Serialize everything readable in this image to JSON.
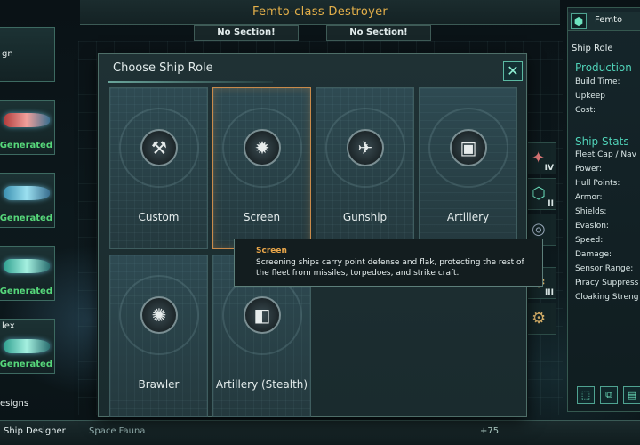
{
  "design": {
    "title": "Femto-class Destroyer",
    "sections": [
      "No Section!",
      "No Section!"
    ]
  },
  "left_list": {
    "card_top_text": [
      "gn",
      "",
      "",
      "",
      "lex"
    ],
    "generated_text": [
      "",
      "-Generated",
      "-Generated",
      "-Generated",
      "-Generated"
    ],
    "designs_label": "esigns"
  },
  "bottom_bar": {
    "tabs": [
      "Ship Designer",
      "Space Fauna"
    ],
    "resource_value": "+75"
  },
  "right_panel": {
    "ship_name": "Femto",
    "ship_role_label": "Ship Role",
    "production": {
      "heading": "Production",
      "lines": [
        "Build Time:",
        "Upkeep",
        "Cost:"
      ]
    },
    "stats": {
      "heading": "Ship Stats",
      "lines": [
        "Fleet Cap / Nav",
        "Power:",
        "Hull Points:",
        "Armor:",
        "Shields:",
        "Evasion:",
        "Speed:",
        "Damage:",
        "Sensor Range:",
        "Piracy Suppress",
        "Cloaking Streng"
      ]
    }
  },
  "module_slots": [
    "IV",
    "II",
    "",
    "III"
  ],
  "dialog": {
    "title": "Choose Ship Role",
    "close_icon": "close-icon",
    "roles": [
      {
        "label": "Custom",
        "icon": "hammer-wrench-icon",
        "glyph": "⚒"
      },
      {
        "label": "Screen",
        "icon": "point-defense-icon",
        "glyph": "✹"
      },
      {
        "label": "Gunship",
        "icon": "fighter-jet-icon",
        "glyph": "✈"
      },
      {
        "label": "Artillery",
        "icon": "cannon-icon",
        "glyph": "▣"
      },
      {
        "label": "Brawler",
        "icon": "burst-icon",
        "glyph": "✺"
      },
      {
        "label": "Artillery (Stealth)",
        "icon": "stealth-cannon-icon",
        "glyph": "◧"
      }
    ],
    "hovered_role": "Screen"
  },
  "tooltip": {
    "title": "Screen",
    "body_line1": "Screening ships carry point defense and flak, protecting the rest of",
    "body_line2": "the fleet from missiles, torpedoes, and strike craft."
  },
  "colors": {
    "accent_teal": "#4fd1b7",
    "title_gold": "#e4b04a",
    "generated_green": "#56d77a",
    "tooltip_title": "#e8a64a"
  }
}
